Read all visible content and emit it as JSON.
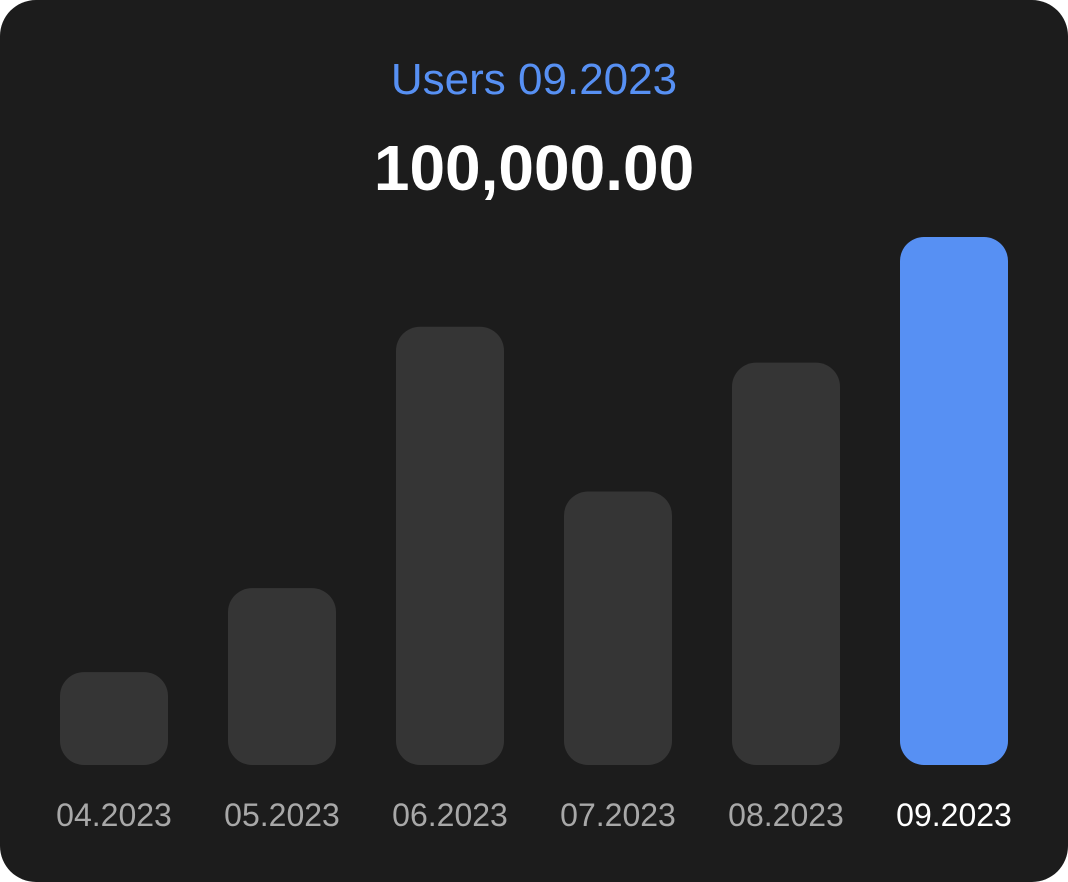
{
  "header": {
    "title": "Users 09.2023",
    "value": "100,000.00"
  },
  "colors": {
    "background": "#1c1c1c",
    "bar": "#353535",
    "highlight": "#5790f3",
    "label": "#a8a8a8",
    "label_active": "#ffffff"
  },
  "chart_data": {
    "type": "bar",
    "title": "Users 09.2023",
    "categories": [
      "04.2023",
      "05.2023",
      "06.2023",
      "07.2023",
      "08.2023",
      "09.2023"
    ],
    "values": [
      17600,
      33500,
      83000,
      51800,
      76200,
      100000
    ],
    "ylim": [
      0,
      100000
    ],
    "highlighted": "09.2023",
    "grid": false,
    "legend": "none"
  }
}
